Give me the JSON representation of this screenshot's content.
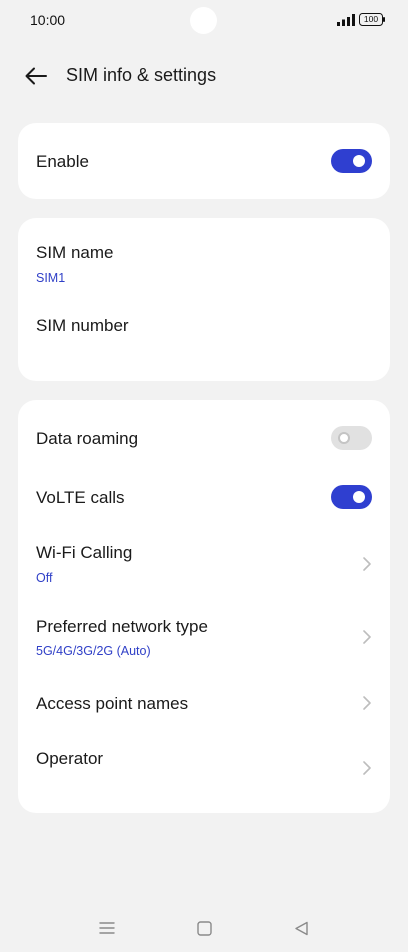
{
  "status_bar": {
    "time": "10:00",
    "battery": "100",
    "icons": [
      "signal-icon",
      "battery-icon"
    ]
  },
  "header": {
    "title": "SIM info & settings",
    "back_icon": "back-arrow-icon"
  },
  "enable_card": {
    "label": "Enable",
    "toggle_on": true
  },
  "sim_card": {
    "name_label": "SIM name",
    "name_value": "SIM1",
    "number_label": "SIM number"
  },
  "settings_card": {
    "data_roaming": {
      "label": "Data roaming",
      "toggle_on": false
    },
    "volte": {
      "label": "VoLTE calls",
      "toggle_on": true
    },
    "wifi_calling": {
      "label": "Wi-Fi Calling",
      "value": "Off"
    },
    "preferred_network": {
      "label": "Preferred network type",
      "value": "5G/4G/3G/2G (Auto)"
    },
    "apn": {
      "label": "Access point names"
    },
    "operator": {
      "label": "Operator"
    }
  },
  "nav_bar": {
    "icons": [
      "menu-icon",
      "home-icon",
      "back-icon"
    ]
  },
  "colors": {
    "accent": "#2f3fd0",
    "background": "#f2f2f2",
    "card": "#ffffff"
  }
}
